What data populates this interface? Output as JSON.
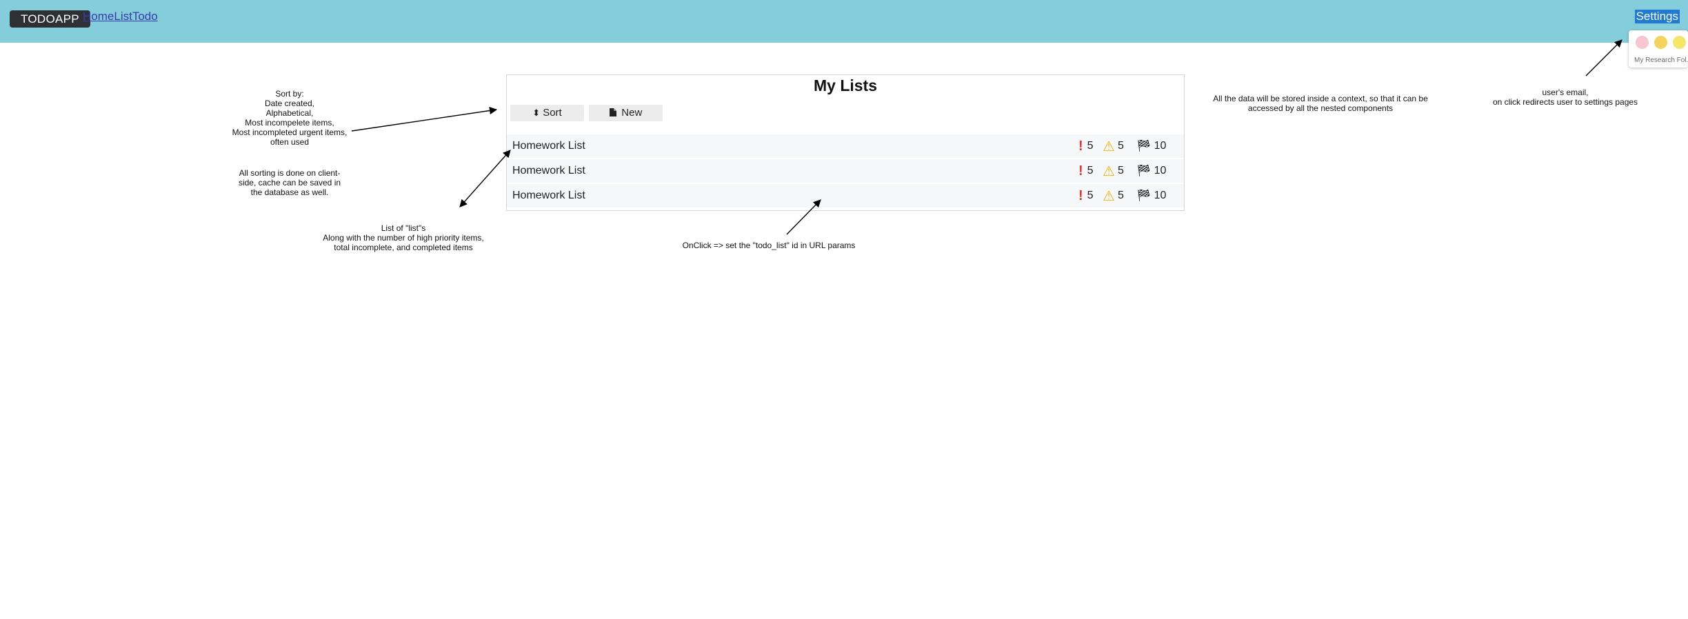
{
  "header": {
    "brand": "TODOAPP",
    "nav": [
      "Home",
      "List",
      "Todo"
    ],
    "settings_label": "Settings",
    "bg_color": "#84cddb"
  },
  "extension_popup": {
    "dot_colors": [
      "#f7c6d0",
      "#f6d35b",
      "#f5e66a"
    ],
    "caption": "My Research Fol..."
  },
  "main": {
    "title": "My Lists",
    "sort_label": "Sort",
    "new_label": "New",
    "sort_icon": "sort-icon",
    "new_icon": "file-icon",
    "lists": [
      {
        "name": "Homework List",
        "priority": "5",
        "incomplete": "5",
        "completed": "10"
      },
      {
        "name": "Homework List",
        "priority": "5",
        "incomplete": "5",
        "completed": "10"
      },
      {
        "name": "Homework List",
        "priority": "5",
        "incomplete": "5",
        "completed": "10"
      }
    ],
    "stat_icons": [
      "exclamation-icon",
      "warning-icon",
      "checkered-flag-icon"
    ]
  },
  "annotations": {
    "sort": [
      "Sort by:",
      "Date created,",
      "Alphabetical,",
      "Most incompelete items,",
      "Most incompleted urgent items,",
      "often used"
    ],
    "client_side": [
      "All sorting is done on client-",
      "side, cache can be saved in",
      "the database as well."
    ],
    "list_of_lists": [
      "List of \"list\"s",
      "Along with the number of high priority items,",
      "total incomplete, and completed items"
    ],
    "onclick": [
      "OnClick => set the \"todo_list\" id in URL params"
    ],
    "context": [
      "All the data will be stored inside a context, so that it can be",
      "accessed by all the nested components"
    ],
    "email": [
      "user's email,",
      "on click redirects user to settings pages"
    ]
  }
}
